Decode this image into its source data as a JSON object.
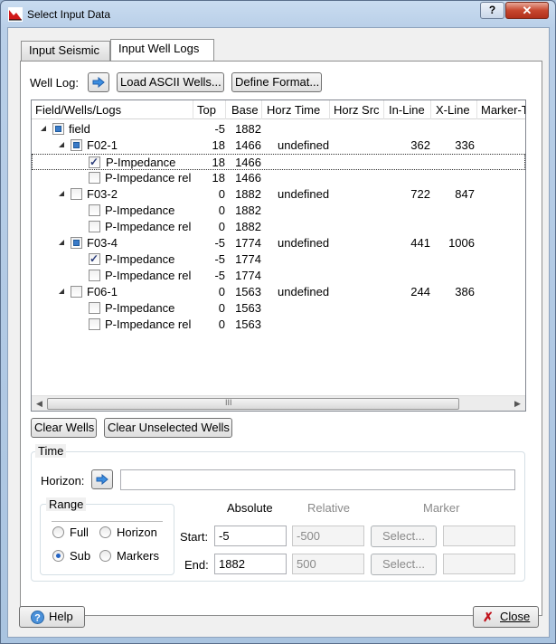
{
  "window": {
    "title": "Select Input Data",
    "help_symbol": "?",
    "close_symbol": "✕"
  },
  "tabs": [
    {
      "label": "Input Seismic"
    },
    {
      "label": "Input Well Logs"
    }
  ],
  "well_log": {
    "label": "Well Log:",
    "load_button": "Load ASCII Wells...",
    "define_button": "Define Format..."
  },
  "tree": {
    "columns": [
      "Field/Wells/Logs",
      "Top",
      "Base",
      "Horz Time",
      "Horz Src",
      "In-Line",
      "X-Line",
      "Marker-T"
    ],
    "rows": [
      {
        "name": "field",
        "top": "-5",
        "base": "1882",
        "horz_time": "",
        "inline": "",
        "xline": ""
      },
      {
        "name": "F02-1",
        "top": "18",
        "base": "1466",
        "horz_time": "undefined",
        "inline": "362",
        "xline": "336"
      },
      {
        "name": "P-Impedance",
        "top": "18",
        "base": "1466",
        "horz_time": "",
        "inline": "",
        "xline": ""
      },
      {
        "name": "P-Impedance rel",
        "top": "18",
        "base": "1466",
        "horz_time": "",
        "inline": "",
        "xline": ""
      },
      {
        "name": "F03-2",
        "top": "0",
        "base": "1882",
        "horz_time": "undefined",
        "inline": "722",
        "xline": "847"
      },
      {
        "name": "P-Impedance",
        "top": "0",
        "base": "1882",
        "horz_time": "",
        "inline": "",
        "xline": ""
      },
      {
        "name": "P-Impedance rel",
        "top": "0",
        "base": "1882",
        "horz_time": "",
        "inline": "",
        "xline": ""
      },
      {
        "name": "F03-4",
        "top": "-5",
        "base": "1774",
        "horz_time": "undefined",
        "inline": "441",
        "xline": "1006"
      },
      {
        "name": "P-Impedance",
        "top": "-5",
        "base": "1774",
        "horz_time": "",
        "inline": "",
        "xline": ""
      },
      {
        "name": "P-Impedance rel",
        "top": "-5",
        "base": "1774",
        "horz_time": "",
        "inline": "",
        "xline": ""
      },
      {
        "name": "F06-1",
        "top": "0",
        "base": "1563",
        "horz_time": "undefined",
        "inline": "244",
        "xline": "386"
      },
      {
        "name": "P-Impedance",
        "top": "0",
        "base": "1563",
        "horz_time": "",
        "inline": "",
        "xline": ""
      },
      {
        "name": "P-Impedance rel",
        "top": "0",
        "base": "1563",
        "horz_time": "",
        "inline": "",
        "xline": ""
      }
    ],
    "scroll_grip": "III"
  },
  "clear_wells_button": "Clear Wells",
  "clear_unselected_button": "Clear Unselected Wells",
  "time": {
    "title": "Time",
    "horizon_label": "Horizon:",
    "horizon_value": "",
    "range": {
      "title": "Range",
      "full": "Full",
      "horizon": "Horizon",
      "sub": "Sub",
      "markers": "Markers"
    },
    "col_absolute": "Absolute",
    "col_relative": "Relative",
    "col_marker": "Marker",
    "start_label": "Start:",
    "end_label": "End:",
    "start_absolute": "-5",
    "end_absolute": "1882",
    "start_relative": "-500",
    "end_relative": "500",
    "select_label": "Select..."
  },
  "footer": {
    "help": "Help",
    "close": "Close"
  }
}
